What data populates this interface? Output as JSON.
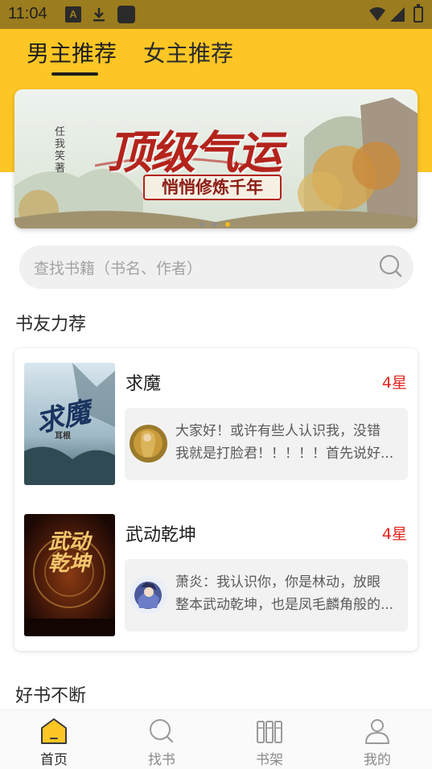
{
  "statusbar": {
    "time": "11:04",
    "notif_letter": "A"
  },
  "tabs": [
    {
      "label": "男主推荐",
      "active": true
    },
    {
      "label": "女主推荐",
      "active": false
    }
  ],
  "banner": {
    "title": "顶级气运",
    "subtitle": "悄悄修炼千年",
    "author": "任我笑著",
    "slide_count": 3,
    "active_slide": 3
  },
  "search": {
    "placeholder": "查找书籍（书名、作者）"
  },
  "section_recommend": {
    "title": "书友力荐"
  },
  "books": [
    {
      "name": "求魔",
      "rating": "4星",
      "cover_text": "求魔",
      "cover_author": "耳根",
      "comment_line1": "大家好！或许有些人认识我，没错",
      "comment_line2": "我就是打脸君！！！！！首先说好..."
    },
    {
      "name": "武动乾坤",
      "rating": "4星",
      "cover_text": "武动乾坤",
      "comment_line1": "萧炎：我认识你，你是林动，放眼",
      "comment_line2": "整本武动乾坤，也是凤毛麟角般的..."
    }
  ],
  "section_good": {
    "title": "好书不断"
  },
  "nav": [
    {
      "label": "首页",
      "icon": "home-icon",
      "active": true
    },
    {
      "label": "找书",
      "icon": "search-icon",
      "active": false
    },
    {
      "label": "书架",
      "icon": "bookshelf-icon",
      "active": false
    },
    {
      "label": "我的",
      "icon": "profile-icon",
      "active": false
    }
  ],
  "colors": {
    "accent": "#fdc625",
    "rating": "#e2251f",
    "statusbar": "#9b7c1e"
  }
}
